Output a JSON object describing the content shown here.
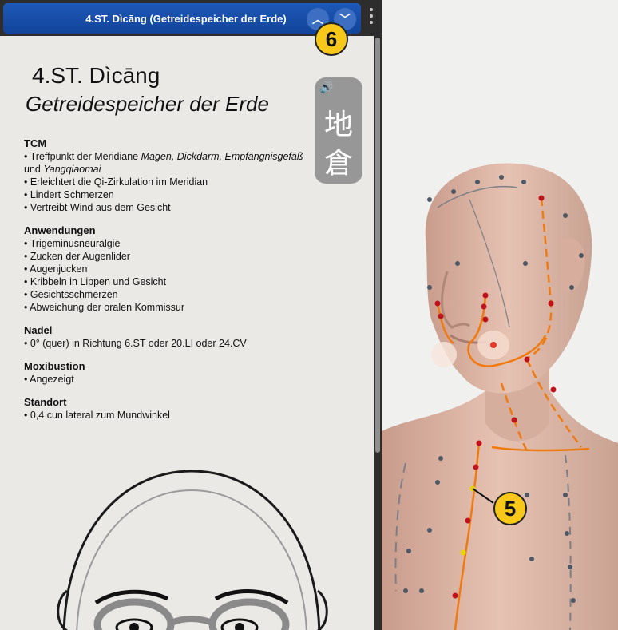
{
  "panel": {
    "title": "4.ST. Dìcāng (Getreidespeicher der Erde)",
    "nav_up_icon": "chevron-up-icon",
    "nav_down_icon": "chevron-down-icon",
    "menu_icon": "more-vertical-icon",
    "close_icon": "close-icon",
    "close_glyph": "✕",
    "up_glyph": "︿",
    "down_glyph": "﹀"
  },
  "point": {
    "heading": "4.ST. Dìcāng",
    "subheading": "Getreidespeicher der Erde",
    "hanzi_1": "地",
    "hanzi_2": "倉",
    "speaker_icon": "speaker-icon",
    "speaker_glyph": "🔊"
  },
  "sections": {
    "tcm": {
      "title": "TCM",
      "line1_pre": "• Treffpunkt der Meridiane ",
      "line1_em": "Magen, Dickdarm, Empfängnisgefäß",
      "line2_pre": "und ",
      "line2_em": "Yangqiaomai",
      "items": [
        "• Erleichtert die Qi-Zirkulation im Meridian",
        "• Lindert Schmerzen",
        "• Vertreibt Wind aus dem Gesicht"
      ]
    },
    "anwendungen": {
      "title": "Anwendungen",
      "items": [
        "• Trigeminusneuralgie",
        "• Zucken der Augenlider",
        "• Augenjucken",
        "• Kribbeln in Lippen und Gesicht",
        "• Gesichtsschmerzen",
        "• Abweichung der oralen Kommissur"
      ]
    },
    "nadel": {
      "title": "Nadel",
      "items": [
        "• 0° (quer) in Richtung 6.ST oder 20.LI oder 24.CV"
      ]
    },
    "moxibustion": {
      "title": "Moxibustion",
      "items": [
        "• Angezeigt"
      ]
    },
    "standort": {
      "title": "Standort",
      "items": [
        "• 0,4 cun lateral zum Mundwinkel"
      ]
    }
  },
  "callouts": {
    "six": "6",
    "five": "5"
  },
  "colors": {
    "accent_blue": "#1e58b7",
    "callout_yellow": "#f7c81a",
    "meridian_orange": "#f07a10",
    "point_red": "#c0121a",
    "point_gray": "#4d5866",
    "skin": "#e2b9a8"
  }
}
